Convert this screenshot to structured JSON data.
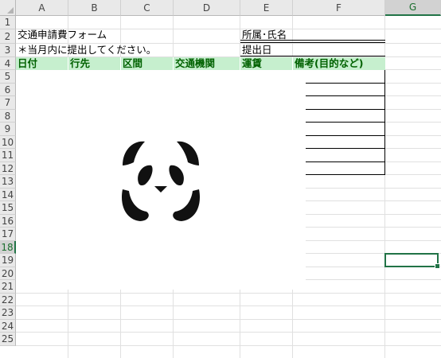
{
  "columns": [
    "A",
    "B",
    "C",
    "D",
    "E",
    "F",
    "G"
  ],
  "selected_column": "G",
  "rows": [
    "1",
    "2",
    "3",
    "4",
    "5",
    "6",
    "7",
    "8",
    "9",
    "10",
    "11",
    "12",
    "13",
    "14",
    "15",
    "16",
    "17",
    "18",
    "19",
    "20",
    "21",
    "22",
    "23",
    "24",
    "25"
  ],
  "selected_row": "18",
  "cells": {
    "A1": "交通申請費フォーム",
    "E1": "所属･氏名",
    "A2": "＊当月内に提出してください。",
    "E2": "提出日"
  },
  "table_header": [
    "日付",
    "行先",
    "区間",
    "交通機関",
    "運賃",
    "備考(目的など)"
  ],
  "colors": {
    "header_fill": "#c6efce",
    "header_text": "#006100",
    "selection": "#217346"
  },
  "image": "panda-icon"
}
